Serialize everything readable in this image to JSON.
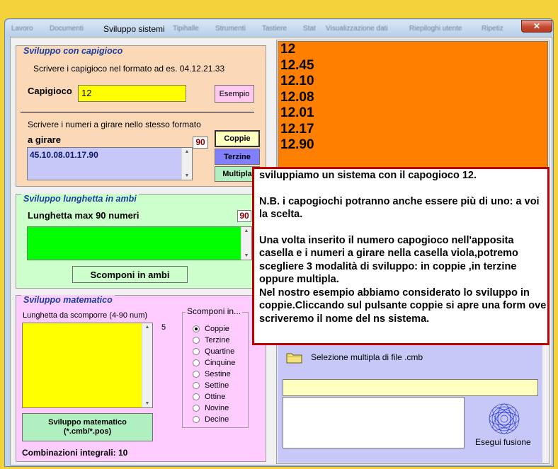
{
  "window": {
    "title": "Sviluppo sistemi",
    "menu_blur": [
      "Lavoro",
      "Documenti",
      "Tipihalle",
      "Strumenti",
      "Tastiere",
      "Stat",
      "Visualizzazione dati",
      "Riepiloghi utente",
      "Ripetiz"
    ],
    "close": "✕"
  },
  "capigioco": {
    "legend": "Sviluppo con capigioco",
    "instructions": "Scrivere i capigioco nel formato ad es. 04.12.21.33",
    "field_label": "Capigioco",
    "field_value": "12",
    "example_button": "Esempio",
    "numbers_instructions": "Scrivere i numeri a girare nello stesso formato",
    "numbers_label": "a girare",
    "count": "90",
    "numbers_value": "45.10.08.01.17.90",
    "buttons": {
      "coppie": "Coppie",
      "terzine": "Terzine",
      "multipla": "Multipla"
    }
  },
  "lunghetta": {
    "legend": "Sviluppo lunghetta in ambi",
    "label": "Lunghetta max 90 numeri",
    "count": "90",
    "button": "Scomponi in ambi"
  },
  "matematico": {
    "legend": "Sviluppo matematico",
    "label": "Lunghetta da scomporre (4-90 num)",
    "value_count": "5",
    "scomponi_legend": "Scomponi in...",
    "options": [
      "Coppie",
      "Terzine",
      "Quartine",
      "Cinquine",
      "Sestine",
      "Settine",
      "Ottine",
      "Novine",
      "Decine"
    ],
    "selected": 0,
    "button_line1": "Sviluppo matematico",
    "button_line2": "(*.cmb/*.pos)",
    "combinations": "Combinazioni integrali: 10"
  },
  "results": {
    "lines": [
      "12",
      "12.45",
      "12.10",
      "12.08",
      "12.01",
      "12.17",
      "12.90"
    ]
  },
  "note": {
    "paragraphs": [
      "sviluppiamo un sistema con il capogioco 12.",
      "N.B. i capogiochi potranno anche essere più di uno: a voi la scelta.",
      "Una volta inserito il numero capogioco nell'apposita casella e i numeri a girare nella casella viola,potremo scegliere 3 modalità di sviluppo: in coppie ,in terzine oppure multipla.\nNel nostro esempio abbiamo considerato lo sviluppo in coppie.Cliccando sul pulsante coppie si apre una form ove scriveremo il nome del ns sistema."
    ]
  },
  "fusion": {
    "multi_select_label": "Selezione multipla di file .cmb",
    "run_button": "Esegui fusione"
  },
  "colors": {
    "orange": "#ff7f00",
    "yellow": "#ffff00",
    "lavender": "#c8c8f8",
    "green": "#00ff00",
    "pink": "#ffccff",
    "note_border": "#c00000"
  }
}
